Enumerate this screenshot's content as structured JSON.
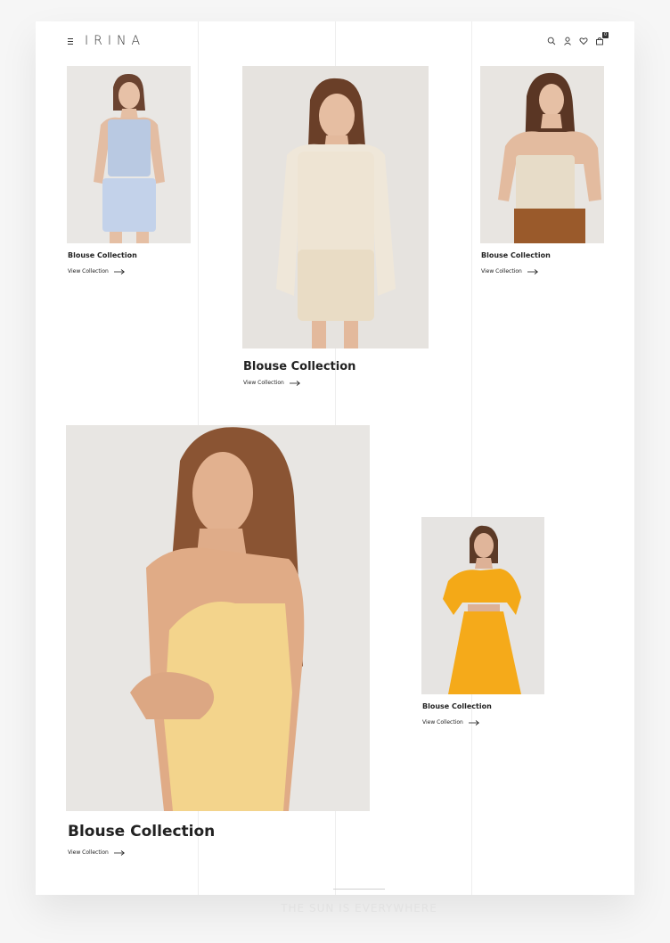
{
  "header": {
    "brand": "IRINA",
    "cart_count": "0"
  },
  "cards": [
    {
      "title": "Blouse Collection",
      "link": "View Collection",
      "photo": "model-blue-crochet-set"
    },
    {
      "title": "Blouse Collection",
      "link": "View Collection",
      "photo": "model-cream-crochet-sweater"
    },
    {
      "title": "Blouse Collection",
      "link": "View Collection",
      "photo": "model-crochet-top-brown-pants"
    },
    {
      "title": "Blouse Collection",
      "link": "View Collection",
      "photo": "model-yellow-satin-camisole"
    },
    {
      "title": "Blouse Collection",
      "link": "View Collection",
      "photo": "model-orange-dress"
    }
  ],
  "footer": {
    "tagline": "THE SUN IS EVERYWHERE"
  },
  "colors": {
    "background": "#f6f6f6",
    "page": "#ffffff",
    "text": "#222222",
    "photo_bg": "#e8e6e4"
  }
}
